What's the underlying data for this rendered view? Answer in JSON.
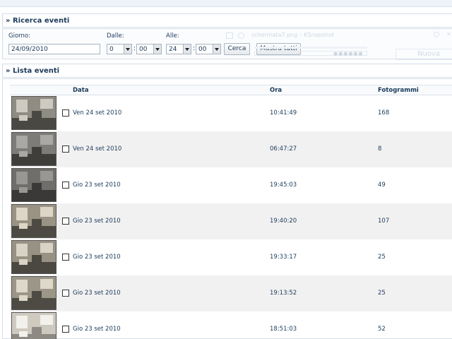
{
  "search": {
    "title": "» Ricerca eventi",
    "day_label": "Giorno:",
    "day_value": "24/09/2010",
    "from_label": "Dalle:",
    "from_hour": "0",
    "from_minute": "00",
    "to_label": "Alle:",
    "to_hour": "24",
    "to_minute": "00",
    "time_separator": ":",
    "search_button": "Cerca",
    "show_all_button": "Mostra tutti"
  },
  "background_window": {
    "title": "schermata7.png – KSnapshot",
    "button_label": "Nuova"
  },
  "events": {
    "title": "» Lista eventi",
    "columns": [
      "Data",
      "Ora",
      "Fotogrammi"
    ],
    "rows": [
      {
        "date": "Ven 24 set 2010",
        "time": "10:41:49",
        "frames": "168"
      },
      {
        "date": "Ven 24 set 2010",
        "time": "06:47:27",
        "frames": "8"
      },
      {
        "date": "Gio 23 set 2010",
        "time": "19:45:03",
        "frames": "49"
      },
      {
        "date": "Gio 23 set 2010",
        "time": "19:40:20",
        "frames": "107"
      },
      {
        "date": "Gio 23 set 2010",
        "time": "19:33:17",
        "frames": "25"
      },
      {
        "date": "Gio 23 set 2010",
        "time": "19:13:52",
        "frames": "25"
      },
      {
        "date": "Gio 23 set 2010",
        "time": "18:51:03",
        "frames": "52"
      }
    ]
  },
  "icons": [
    "dropdown-arrow-icon",
    "checkbox-icon",
    "camera-thumbnail"
  ],
  "colors": {
    "text": "#1b3a5a",
    "row_alt": "#f1f1f1",
    "border": "#d3dde7"
  }
}
